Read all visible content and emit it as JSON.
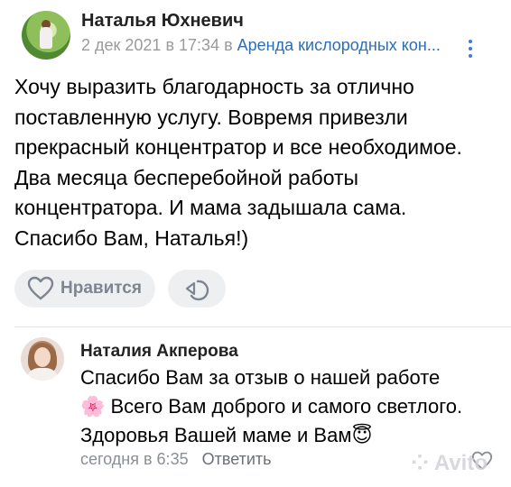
{
  "review": {
    "author": "Наталья Юхневич",
    "date": "2 дек 2021 в 17:34",
    "preposition": "в",
    "topic": "Аренда кислородных кон...",
    "text_lines": [
      "Хочу выразить благодарность  за отлично",
      "поставленную услугу. Вовремя привезли",
      "прекрасный концентратор и все необходимое.",
      "Два месяца бесперебойной работы",
      "концентратора. И мама задышала сама.",
      "Спасибо Вам, Наталья!)"
    ],
    "like_label": "Нравится"
  },
  "reply": {
    "author": "Наталия Акперова",
    "text_lines": [
      "Спасибо Вам за отзыв о нашей работе",
      "🌸 Всего Вам доброго и самого светлого.",
      "Здоровья Вашей маме и Вам😇"
    ],
    "time": "сегодня в 6:35",
    "reply_label": "Ответить"
  },
  "watermark": "Avito",
  "colors": {
    "link": "#2a6fb6",
    "meta": "#9a9a9a",
    "button_bg": "#eeeff1",
    "button_text": "#7d858f"
  }
}
